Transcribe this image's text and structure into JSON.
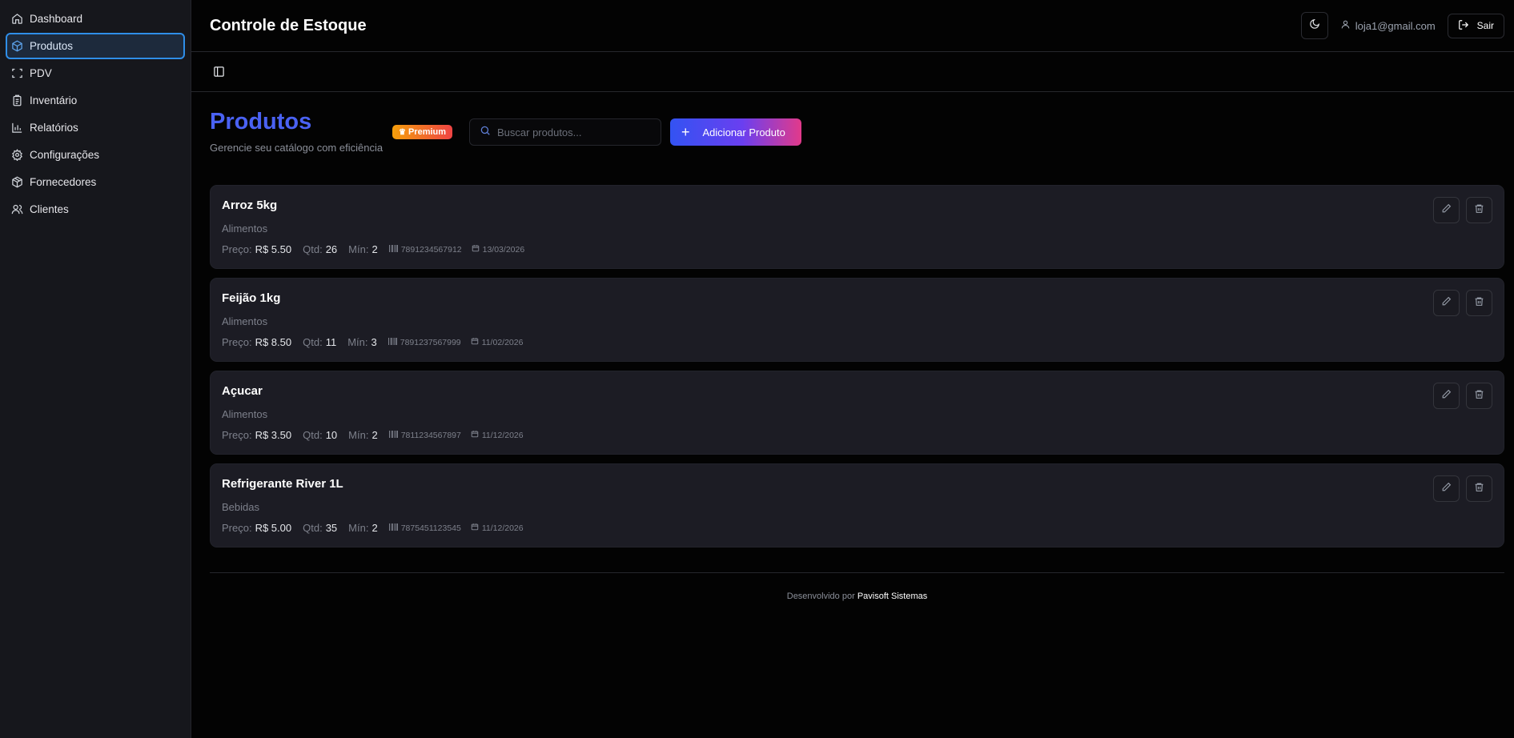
{
  "sidebar": {
    "items": [
      {
        "label": "Dashboard",
        "icon": "home-icon"
      },
      {
        "label": "Produtos",
        "icon": "package-icon",
        "active": true
      },
      {
        "label": "PDV",
        "icon": "scan-icon"
      },
      {
        "label": "Inventário",
        "icon": "clipboard-icon"
      },
      {
        "label": "Relatórios",
        "icon": "bar-chart-icon"
      },
      {
        "label": "Configurações",
        "icon": "gear-icon"
      },
      {
        "label": "Fornecedores",
        "icon": "box-icon"
      },
      {
        "label": "Clientes",
        "icon": "users-icon"
      }
    ]
  },
  "header": {
    "title": "Controle de Estoque",
    "user_email": "loja1@gmail.com",
    "logout_label": "Sair"
  },
  "page": {
    "title": "Produtos",
    "subtitle": "Gerencie seu catálogo com eficiência",
    "badge": "Premium",
    "search_placeholder": "Buscar produtos...",
    "add_label": "Adicionar Produto"
  },
  "labels": {
    "price": "Preço:",
    "qty": "Qtd:",
    "min": "Mín:"
  },
  "products": [
    {
      "name": "Arroz 5kg",
      "category": "Alimentos",
      "price": "R$ 5.50",
      "qty": "26",
      "min": "2",
      "barcode": "7891234567912",
      "date": "13/03/2026"
    },
    {
      "name": "Feijão 1kg",
      "category": "Alimentos",
      "price": "R$ 8.50",
      "qty": "11",
      "min": "3",
      "barcode": "7891237567999",
      "date": "11/02/2026"
    },
    {
      "name": "Açucar",
      "category": "Alimentos",
      "price": "R$ 3.50",
      "qty": "10",
      "min": "2",
      "barcode": "7811234567897",
      "date": "11/12/2026"
    },
    {
      "name": "Refrigerante River 1L",
      "category": "Bebidas",
      "price": "R$ 5.00",
      "qty": "35",
      "min": "2",
      "barcode": "7875451123545",
      "date": "11/12/2026"
    }
  ],
  "footer": {
    "prefix": "Desenvolvido por",
    "brand": "Pavisoft Sistemas"
  },
  "colors": {
    "accent": "#4a62f3",
    "active_border": "#2f8ee8"
  }
}
